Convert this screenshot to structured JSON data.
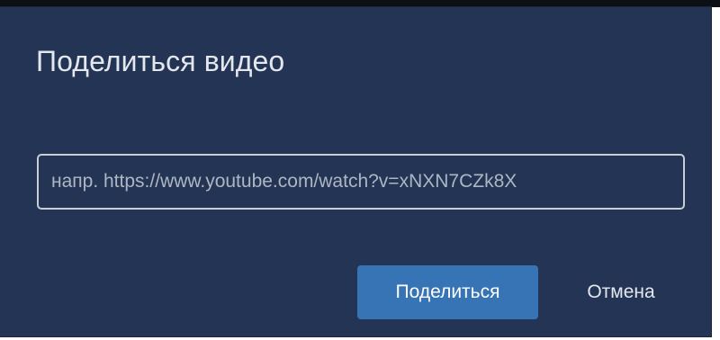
{
  "dialog": {
    "title": "Поделиться видео",
    "url_input": {
      "value": "",
      "placeholder": "напр. https://www.youtube.com/watch?v=xNXN7CZk8X"
    },
    "share_label": "Поделиться",
    "cancel_label": "Отмена"
  },
  "colors": {
    "dialog_background": "#233454",
    "primary_button": "#3674b6",
    "text": "#e4e8ee"
  }
}
